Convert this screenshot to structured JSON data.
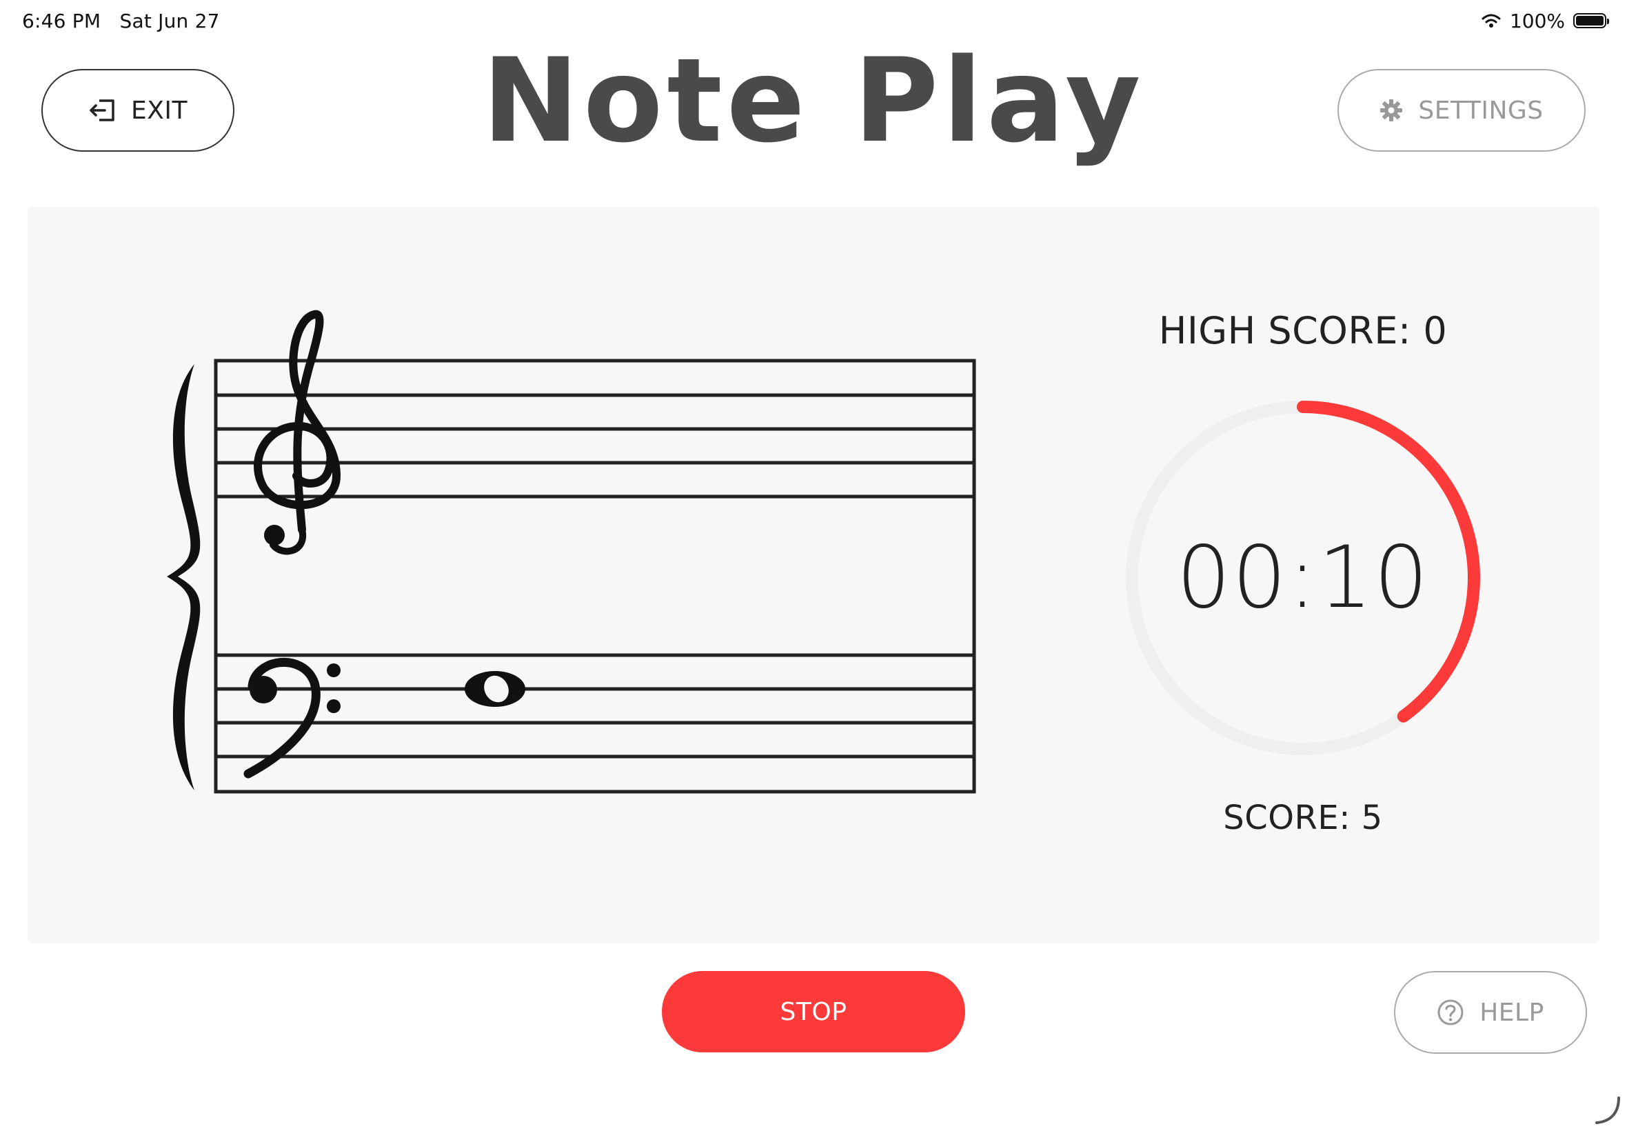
{
  "status_bar": {
    "time": "6:46 PM",
    "date": "Sat Jun 27",
    "battery": "100%",
    "icons": [
      "wifi-icon",
      "battery-icon"
    ]
  },
  "header": {
    "title": "Note Play",
    "exit_label": "EXIT",
    "settings_label": "SETTINGS"
  },
  "game": {
    "high_score_label": "HIGH SCORE: 0",
    "timer": "00:10",
    "timer_progress": 0.4,
    "score_label": "SCORE: 5",
    "note": {
      "clef": "bass",
      "type": "whole-note"
    }
  },
  "footer": {
    "stop_label": "STOP",
    "help_label": "HELP"
  },
  "colors": {
    "accent": "#fc3a3a",
    "title": "#4a4a4a",
    "panel": "#f7f7f7",
    "muted": "#999999"
  }
}
